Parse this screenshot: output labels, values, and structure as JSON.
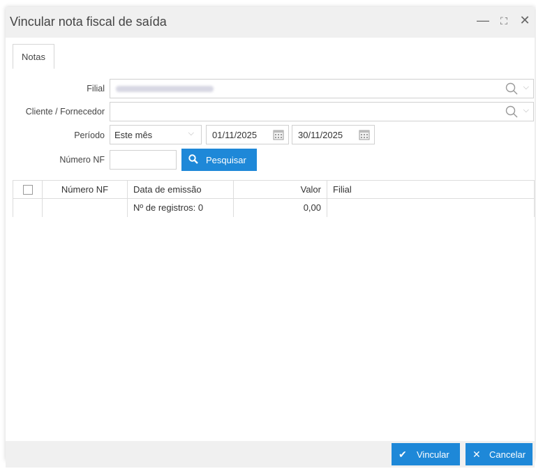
{
  "dialog": {
    "title": "Vincular nota fiscal de saída"
  },
  "window_controls": {
    "minimize": "—",
    "maximize": "⛶",
    "close": "✕"
  },
  "tabs": [
    {
      "label": "Notas"
    }
  ],
  "form": {
    "filial_label": "Filial",
    "cliente_label": "Cliente / Fornecedor",
    "periodo_label": "Período",
    "periodo_value": "Este mês",
    "data_inicio": "01/11/2025",
    "data_fim": "30/11/2025",
    "numero_nf_label": "Número NF",
    "search_button": "Pesquisar"
  },
  "grid": {
    "columns": [
      "",
      "Número NF",
      "Data de emissão",
      "Valor",
      "Filial"
    ],
    "summary": {
      "registros": "Nº de registros: 0",
      "valor": "0,00"
    }
  },
  "footer": {
    "vincular": "Vincular",
    "cancelar": "Cancelar"
  },
  "colors": {
    "accent": "#1e88d8",
    "titlebar": "#f0f0f0"
  }
}
